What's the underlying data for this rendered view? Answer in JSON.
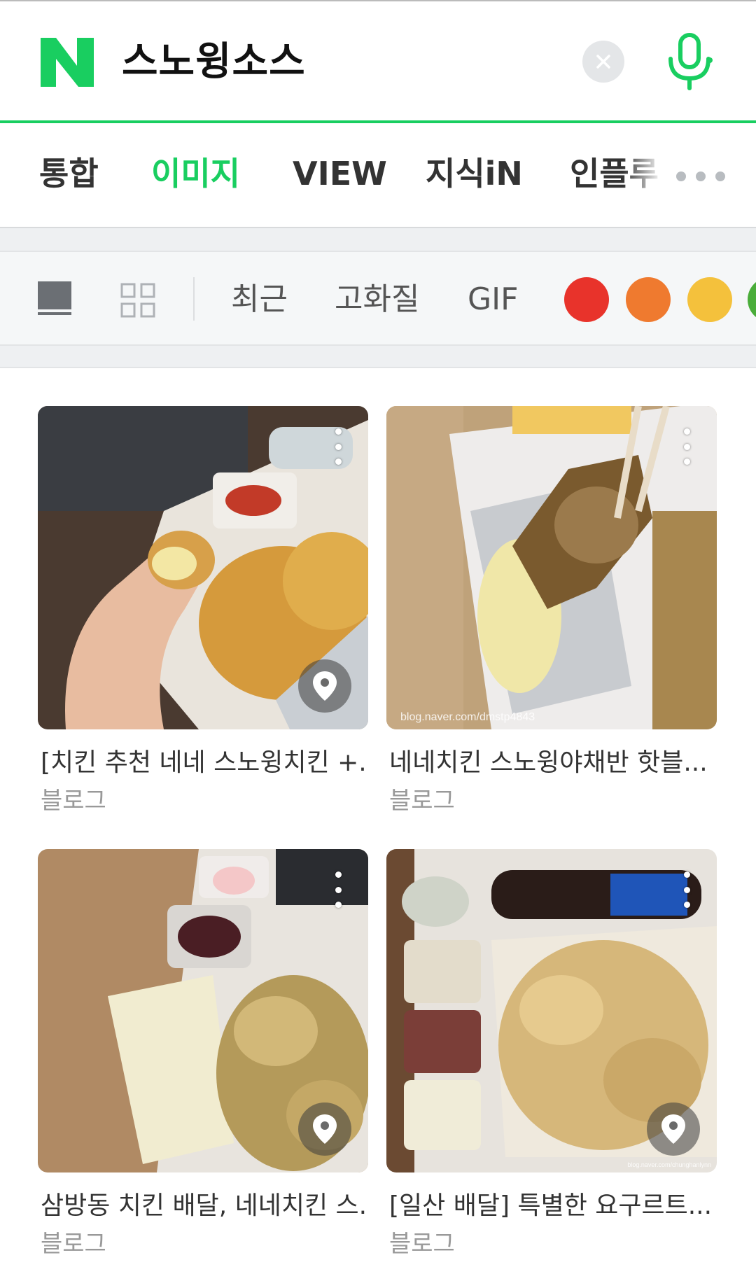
{
  "search": {
    "query": "스노윙소스",
    "brand_color": "#19ce60"
  },
  "icons": {
    "logo": "naver-n-logo",
    "clear": "close-icon",
    "mic": "microphone-icon"
  },
  "tabs": [
    {
      "label": "통합",
      "active": false
    },
    {
      "label": "이미지",
      "active": true
    },
    {
      "label": "VIEW",
      "active": false
    },
    {
      "label": "지식iN",
      "active": false
    },
    {
      "label": "인플루",
      "active": false
    }
  ],
  "filters": {
    "items": [
      "최근",
      "고화질",
      "GIF"
    ],
    "colors": [
      "#e8332b",
      "#ef7a2f",
      "#f4c13c",
      "#4aad3a"
    ]
  },
  "results": [
    {
      "title": "[치킨 추천 네네 스노윙치킨 +...",
      "source": "블로그",
      "watermark": ""
    },
    {
      "title": "네네치킨 스노윙야채반 핫블...",
      "source": "블로그",
      "watermark": "blog.naver.com/dmstp4843"
    },
    {
      "title": "삼방동 치킨 배달, 네네치킨 스...",
      "source": "블로그",
      "watermark": ""
    },
    {
      "title": "[일산 배달] 특별한 요구르트...",
      "source": "블로그",
      "watermark": "blog.naver.com/chunghanlynn"
    }
  ]
}
